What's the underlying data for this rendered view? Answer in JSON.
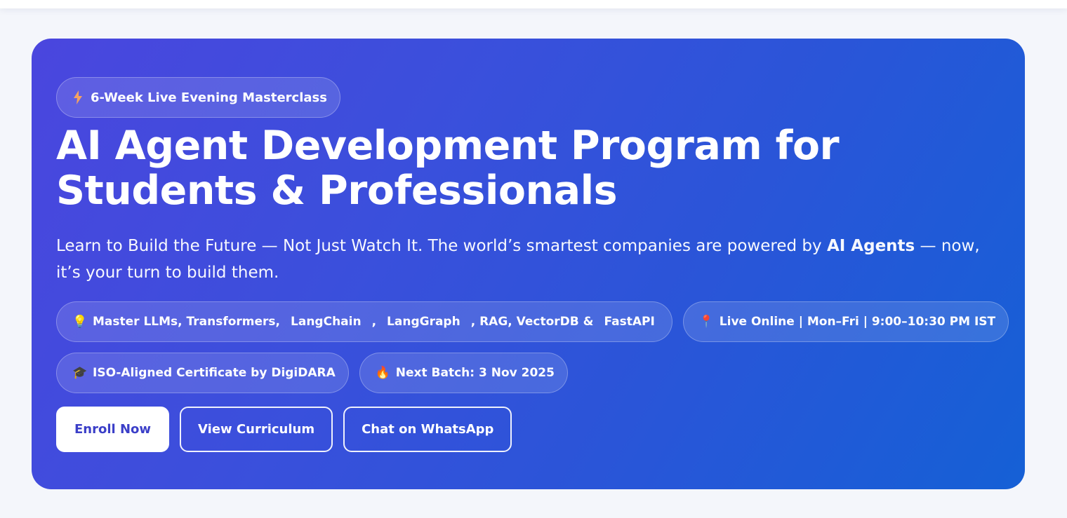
{
  "hero": {
    "tag": {
      "icon": "lightning-bolt-icon",
      "label": "6-Week Live Evening Masterclass"
    },
    "title": "AI Agent Development Program for Students & Professionals",
    "subtitle": {
      "before": "Learn to Build the Future — Not Just Watch It. The world’s smartest companies are powered by ",
      "bold": "AI Agents",
      "after": " — now, it’s your turn to build them."
    },
    "skills_chip": {
      "icon": "lightbulb-icon",
      "part1": "Master LLMs, Transformers,",
      "kw1": "LangChain",
      "sep": ",",
      "kw2": "LangGraph",
      "part2": ", RAG, VectorDB &",
      "kw3": "FastAPI"
    },
    "chips": [
      {
        "icon": "location-pin-icon",
        "label": "Live Online | Mon–Fri | 9:00–10:30 PM IST"
      },
      {
        "icon": "graduation-cap-icon",
        "label": "ISO-Aligned Certificate by DigiDARA"
      },
      {
        "icon": "fire-icon",
        "label": "Next Batch: 3 Nov 2025"
      }
    ],
    "buttons": {
      "enroll": "Enroll Now",
      "curriculum": "View Curriculum",
      "whatsapp": "Chat on WhatsApp"
    }
  },
  "colors": {
    "gradient_start": "#4a46de",
    "gradient_end": "#1560d6",
    "primary_button_text": "#3b3fc8",
    "page_background": "#f4f6fb"
  }
}
